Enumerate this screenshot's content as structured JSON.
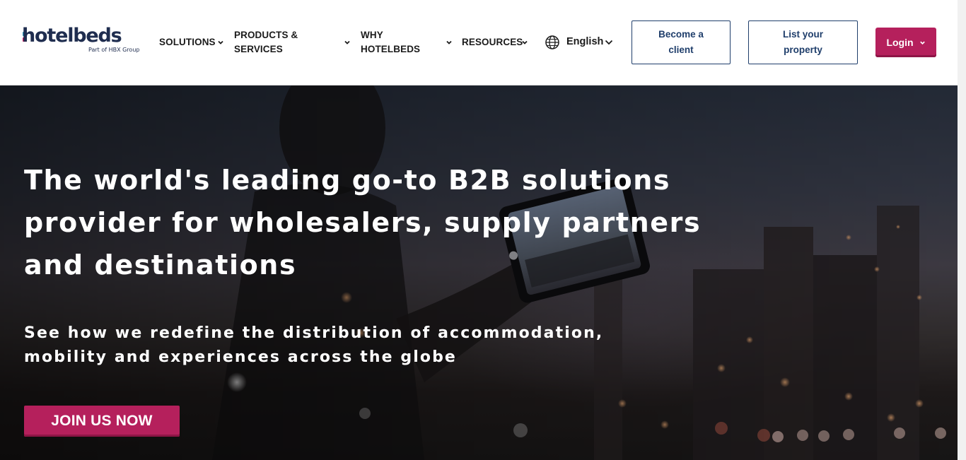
{
  "logo": {
    "wordmark": "hotelbeds",
    "tagline": "Part of HBX Group"
  },
  "nav": {
    "items": [
      {
        "label": "SOLUTIONS"
      },
      {
        "label_line1": "PRODUCTS &",
        "label_line2": "SERVICES"
      },
      {
        "label_line1": "WHY",
        "label_line2": "HOTELBEDS"
      },
      {
        "label": "RESOURCES"
      }
    ],
    "language": "English"
  },
  "actions": {
    "become_client_line1": "Become a",
    "become_client_line2": "client",
    "list_property_line1": "List your",
    "list_property_line2": "property",
    "login": "Login"
  },
  "hero": {
    "title": "The world's leading go-to B2B solutions provider for wholesalers, supply partners and destinations",
    "subtitle_line1": "See how we redefine the distribution of accommodation,",
    "subtitle_line2": "mobility and experiences across the globe",
    "cta": "JOIN US NOW"
  },
  "colors": {
    "brand_navy": "#1f2d4f",
    "accent_magenta": "#b5205c",
    "button_outline": "#1f3e6b",
    "logo_teal": "#2c8fb1"
  },
  "icons": [
    "chevron-down-icon",
    "globe-icon"
  ]
}
